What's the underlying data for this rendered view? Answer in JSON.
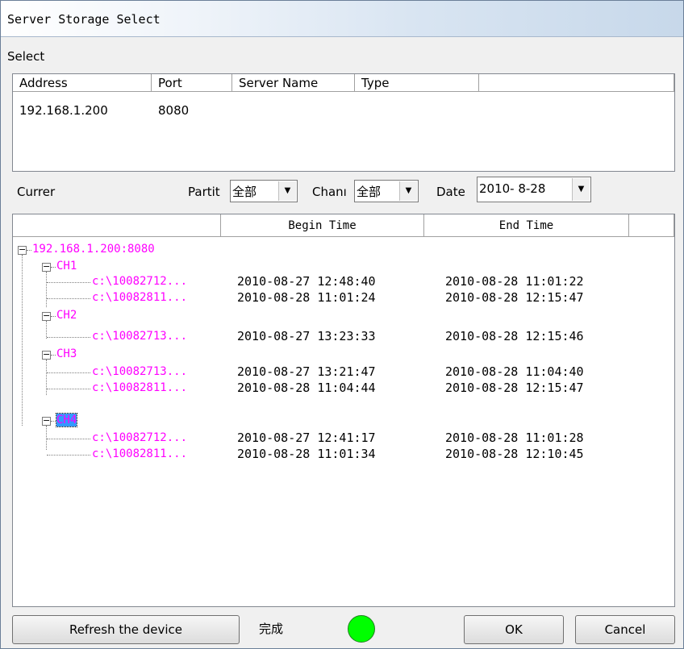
{
  "window": {
    "title": "Server Storage Select"
  },
  "select_label": "Select",
  "server_list": {
    "columns": [
      "Address",
      "Port",
      "Server Name",
      "Type",
      ""
    ],
    "rows": [
      {
        "address": "192.168.1.200",
        "port": "8080",
        "server_name": "",
        "type": ""
      }
    ]
  },
  "filters": {
    "current_label": "Currer",
    "partition_label": "Partit",
    "partition_value": "全部",
    "channel_label": "Chanı",
    "channel_value": "全部",
    "date_label": "Date",
    "date_value": "2010- 8-28"
  },
  "tree": {
    "columns": [
      "",
      "Begin Time",
      "End Time",
      ""
    ],
    "root": "192.168.1.200:8080",
    "channels": [
      {
        "name": "CH1",
        "files": [
          {
            "name": "c:\\10082712...",
            "begin": "2010-08-27 12:48:40",
            "end": "2010-08-28 11:01:22"
          },
          {
            "name": "c:\\10082811...",
            "begin": "2010-08-28 11:01:24",
            "end": "2010-08-28 12:15:47"
          }
        ]
      },
      {
        "name": "CH2",
        "files": [
          {
            "name": "c:\\10082713...",
            "begin": "2010-08-27 13:23:33",
            "end": "2010-08-28 12:15:46"
          }
        ]
      },
      {
        "name": "CH3",
        "files": [
          {
            "name": "c:\\10082713...",
            "begin": "2010-08-27 13:21:47",
            "end": "2010-08-28 11:04:40"
          },
          {
            "name": "c:\\10082811...",
            "begin": "2010-08-28 11:04:44",
            "end": "2010-08-28 12:15:47"
          }
        ]
      },
      {
        "name": "CH4",
        "selected": true,
        "files": [
          {
            "name": "c:\\10082712...",
            "begin": "2010-08-27 12:41:17",
            "end": "2010-08-28 11:01:28"
          },
          {
            "name": "c:\\10082811...",
            "begin": "2010-08-28 11:01:34",
            "end": "2010-08-28 12:10:45"
          }
        ]
      }
    ]
  },
  "footer": {
    "refresh_label": "Refresh the device",
    "status_text": "完成",
    "status_color": "#00ff00",
    "ok_label": "OK",
    "cancel_label": "Cancel"
  }
}
